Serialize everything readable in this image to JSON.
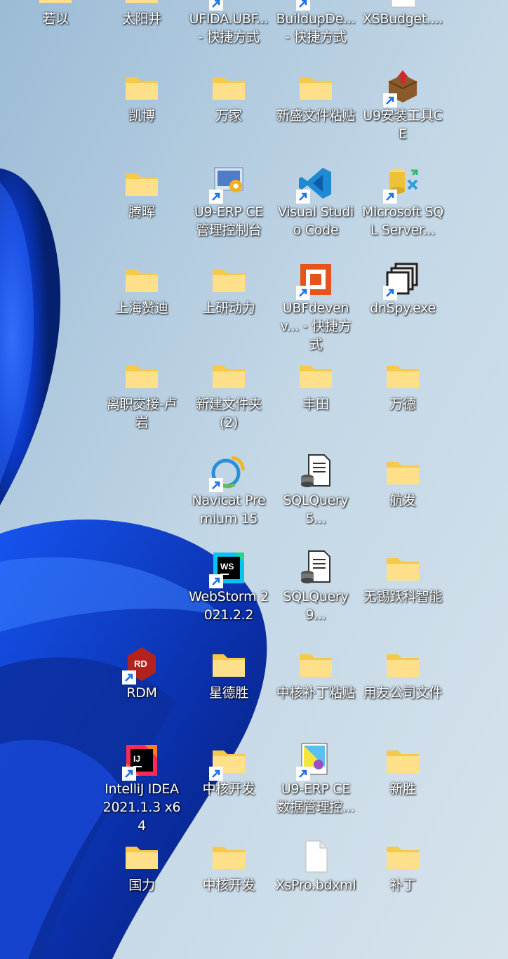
{
  "desktop": {
    "icons": [
      {
        "label": "若以",
        "icon": "folder-icon",
        "shortcut": false
      },
      {
        "label": "太阳井",
        "icon": "folder-icon",
        "shortcut": false
      },
      {
        "label": "UFIDA.UBF... - 快捷方式",
        "icon": "ufida-app-icon",
        "shortcut": true
      },
      {
        "label": "BuildupDe... - 快捷方式",
        "icon": "buildup-app-icon",
        "shortcut": true
      },
      {
        "label": "XSBudget....",
        "icon": "document-icon",
        "shortcut": false
      },
      {
        "label": "凯博",
        "icon": "folder-icon",
        "shortcut": false
      },
      {
        "label": "万家",
        "icon": "folder-icon",
        "shortcut": false
      },
      {
        "label": "新盛文件粘贴",
        "icon": "folder-icon",
        "shortcut": false
      },
      {
        "label": "U9安装工具CE",
        "icon": "installer-box-icon",
        "shortcut": true
      },
      {
        "label": "腾晖",
        "icon": "folder-icon",
        "shortcut": false
      },
      {
        "label": "U9-ERP CE 管理控制台",
        "icon": "u9-console-icon",
        "shortcut": true
      },
      {
        "label": "Visual Studio Code",
        "icon": "vscode-icon",
        "shortcut": true
      },
      {
        "label": "Microsoft SQL Server...",
        "icon": "sql-server-icon",
        "shortcut": true
      },
      {
        "label": "上海赞迪",
        "icon": "folder-icon",
        "shortcut": false
      },
      {
        "label": "上研动力",
        "icon": "folder-icon",
        "shortcut": false
      },
      {
        "label": "UBFdevenv... - 快捷方式",
        "icon": "ubf-devenv-icon",
        "shortcut": true
      },
      {
        "label": "dnSpy.exe",
        "icon": "dnspy-icon",
        "shortcut": true
      },
      {
        "label": "离职交接-卢岩",
        "icon": "folder-icon",
        "shortcut": false
      },
      {
        "label": "新建文件夹 (2)",
        "icon": "folder-icon",
        "shortcut": false
      },
      {
        "label": "丰田",
        "icon": "folder-icon",
        "shortcut": false
      },
      {
        "label": "万德",
        "icon": "folder-icon",
        "shortcut": false
      },
      {
        "label": "Navicat Premium 15",
        "icon": "navicat-icon",
        "shortcut": true
      },
      {
        "label": "SQLQuery5...",
        "icon": "sql-query-icon",
        "shortcut": false
      },
      {
        "label": "航发",
        "icon": "folder-icon",
        "shortcut": false
      },
      {
        "label": "WebStorm 2021.2.2",
        "icon": "webstorm-icon",
        "shortcut": true
      },
      {
        "label": "SQLQuery9...",
        "icon": "sql-query-icon",
        "shortcut": false
      },
      {
        "label": "无锡跃科智能",
        "icon": "folder-icon",
        "shortcut": false
      },
      {
        "label": "RDM",
        "icon": "rdm-icon",
        "shortcut": true
      },
      {
        "label": "星德胜",
        "icon": "folder-icon",
        "shortcut": false
      },
      {
        "label": "中核补丁粘贴",
        "icon": "folder-icon",
        "shortcut": false
      },
      {
        "label": "用友公司文件",
        "icon": "folder-icon",
        "shortcut": false
      },
      {
        "label": "IntelliJ IDEA 2021.1.3 x64",
        "icon": "intellij-icon",
        "shortcut": true
      },
      {
        "label": "中核开发",
        "icon": "folder-icon",
        "shortcut": true
      },
      {
        "label": "U9-ERP CE 数据管理控...",
        "icon": "u9-data-icon",
        "shortcut": true
      },
      {
        "label": "新胜",
        "icon": "folder-icon",
        "shortcut": false
      },
      {
        "label": "国力",
        "icon": "folder-icon",
        "shortcut": false
      },
      {
        "label": "中核开发",
        "icon": "folder-icon",
        "shortcut": false
      },
      {
        "label": "XsPro.bdxml",
        "icon": "file-icon",
        "shortcut": false
      },
      {
        "label": "补丁",
        "icon": "folder-icon",
        "shortcut": false
      }
    ]
  },
  "colors": {
    "folder": "#F7C948",
    "folder_light": "#FFE08A",
    "shortcut_arrow": "#1E73E8",
    "wallpaper_light": "#C9DCEB",
    "wallpaper_dark": "#0A2FA8"
  }
}
